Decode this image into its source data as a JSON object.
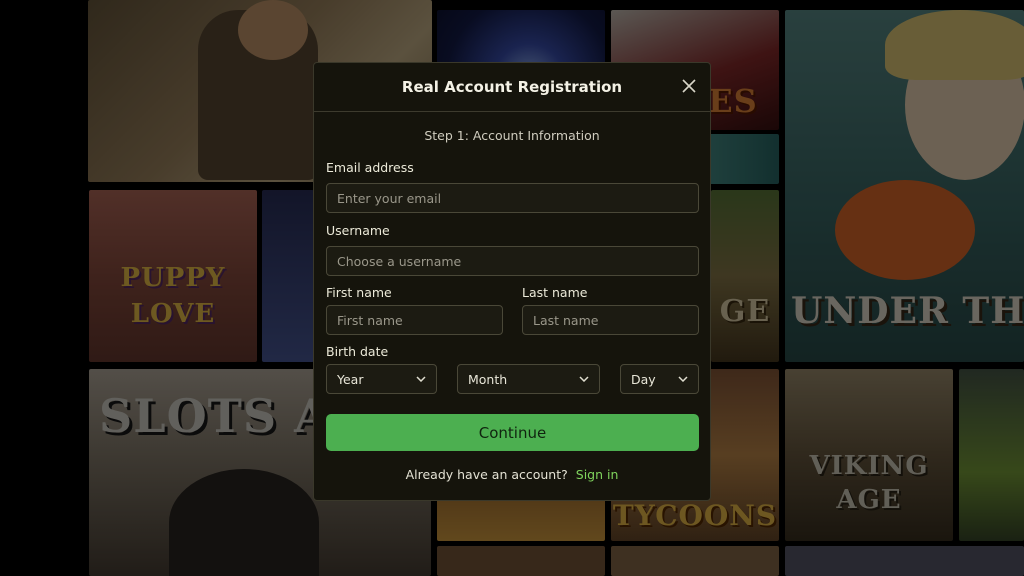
{
  "modal": {
    "title": "Real Account Registration",
    "step": "Step 1: Account Information",
    "email": {
      "label": "Email address",
      "placeholder": "Enter your email"
    },
    "username": {
      "label": "Username",
      "placeholder": "Choose a username"
    },
    "first_name": {
      "label": "First name",
      "placeholder": "First name"
    },
    "last_name": {
      "label": "Last name",
      "placeholder": "Last name"
    },
    "birth_date": {
      "label": "Birth date",
      "year": "Year",
      "month": "Month",
      "day": "Day"
    },
    "continue_label": "Continue",
    "signin_prompt": "Already have an account?",
    "signin_link": "Sign in"
  },
  "background_tiles": {
    "puppy_love": "PUPPY LOVE",
    "slots_angels": "SLOTS A",
    "under_the_sea": "UNDER THE",
    "viking_age": "VIKING AGE",
    "tycoons": "TYCOONS",
    "ries": "IES",
    "ge": "GE"
  },
  "colors": {
    "modal_bg": "#15140c",
    "accent_green": "#4caf50",
    "link_green": "#7fd35d"
  },
  "icons": {
    "close": "close-icon",
    "dropdown": "chevron-down-icon"
  }
}
